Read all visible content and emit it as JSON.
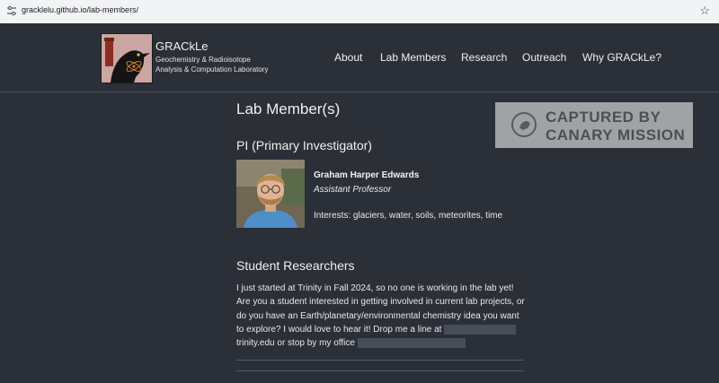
{
  "browser": {
    "url": "gracklelu.github.io/lab-members/"
  },
  "site": {
    "title": "GRACkLe",
    "subtitle_line1": "Geochemistry & Radioisotope",
    "subtitle_line2": "Analysis & Computation Laboratory",
    "nav": [
      "About",
      "Lab Members",
      "Research",
      "Outreach",
      "Why GRACkLe?"
    ]
  },
  "page": {
    "heading": "Lab Member(s)",
    "pi_heading": "PI (Primary Investigator)",
    "pi": {
      "name": "Graham Harper Edwards",
      "role": "Assistant Professor",
      "interests": "Interests: glaciers, water, soils, meteorites, time"
    },
    "students_heading": "Student Researchers",
    "students_lines": [
      "I just started at Trinity in Fall 2024, so no one is working in the lab yet!",
      "Are you a student interested in getting involved in current lab projects, or",
      "do you have an Earth/planetary/environmental chemistry idea you want",
      "to explore? I would love to hear it! Drop me a line at",
      "trinity.edu or stop by my office"
    ]
  },
  "watermark": {
    "line1": "CAPTURED BY",
    "line2": "CANARY MISSION"
  },
  "colors": {
    "background": "#2b2f38",
    "logo_bg": "#caa6a2",
    "watermark_bg": "#a9acaf",
    "watermark_text": "#4e535a"
  },
  "icons": [
    "site-settings-icon",
    "bookmark-star-icon",
    "grackle-logo",
    "canary-bird-icon"
  ]
}
